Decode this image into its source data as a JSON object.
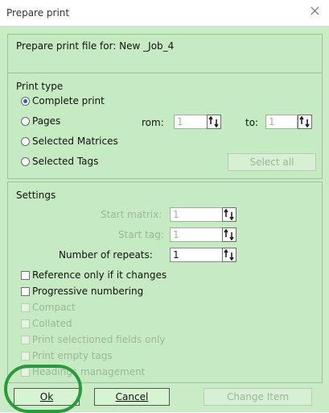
{
  "window": {
    "title": "Prepare print",
    "close_glyph": "×"
  },
  "header": {
    "prepare_text": "Prepare print file for: New _Job_4"
  },
  "print_type": {
    "label": "Print type",
    "options": [
      {
        "label": "Complete print",
        "checked": true
      },
      {
        "label": "Pages",
        "checked": false
      },
      {
        "label": "Selected Matrices",
        "checked": false
      },
      {
        "label": "Selected Tags",
        "checked": false
      }
    ],
    "from_label": "rom:",
    "from_value": "1",
    "to_label": "to:",
    "to_value": "1",
    "select_all_label": "Select all"
  },
  "settings": {
    "label": "Settings",
    "start_matrix_label": "Start matrix:",
    "start_matrix_value": "1",
    "start_tag_label": "Start tag:",
    "start_tag_value": "1",
    "repeats_label": "Number of repeats:",
    "repeats_value": "1",
    "checkboxes": [
      {
        "label": "Reference only if it changes",
        "enabled": true
      },
      {
        "label": "Progressive numbering",
        "enabled": true
      },
      {
        "label": "Compact",
        "enabled": false
      },
      {
        "label": "Collated",
        "enabled": false
      },
      {
        "label": "Print selectioned fields only",
        "enabled": false
      },
      {
        "label": "Print empty tags",
        "enabled": false
      },
      {
        "label": "Headings management",
        "enabled": false
      }
    ]
  },
  "footer": {
    "ok_label": "Ok",
    "cancel_label": "Cancel",
    "change_item_label": "Change Item"
  },
  "colors": {
    "dialog_bg": "#c9ebc6",
    "highlight_circle": "#2b9a3c",
    "radio_accent": "#1f62c6"
  }
}
